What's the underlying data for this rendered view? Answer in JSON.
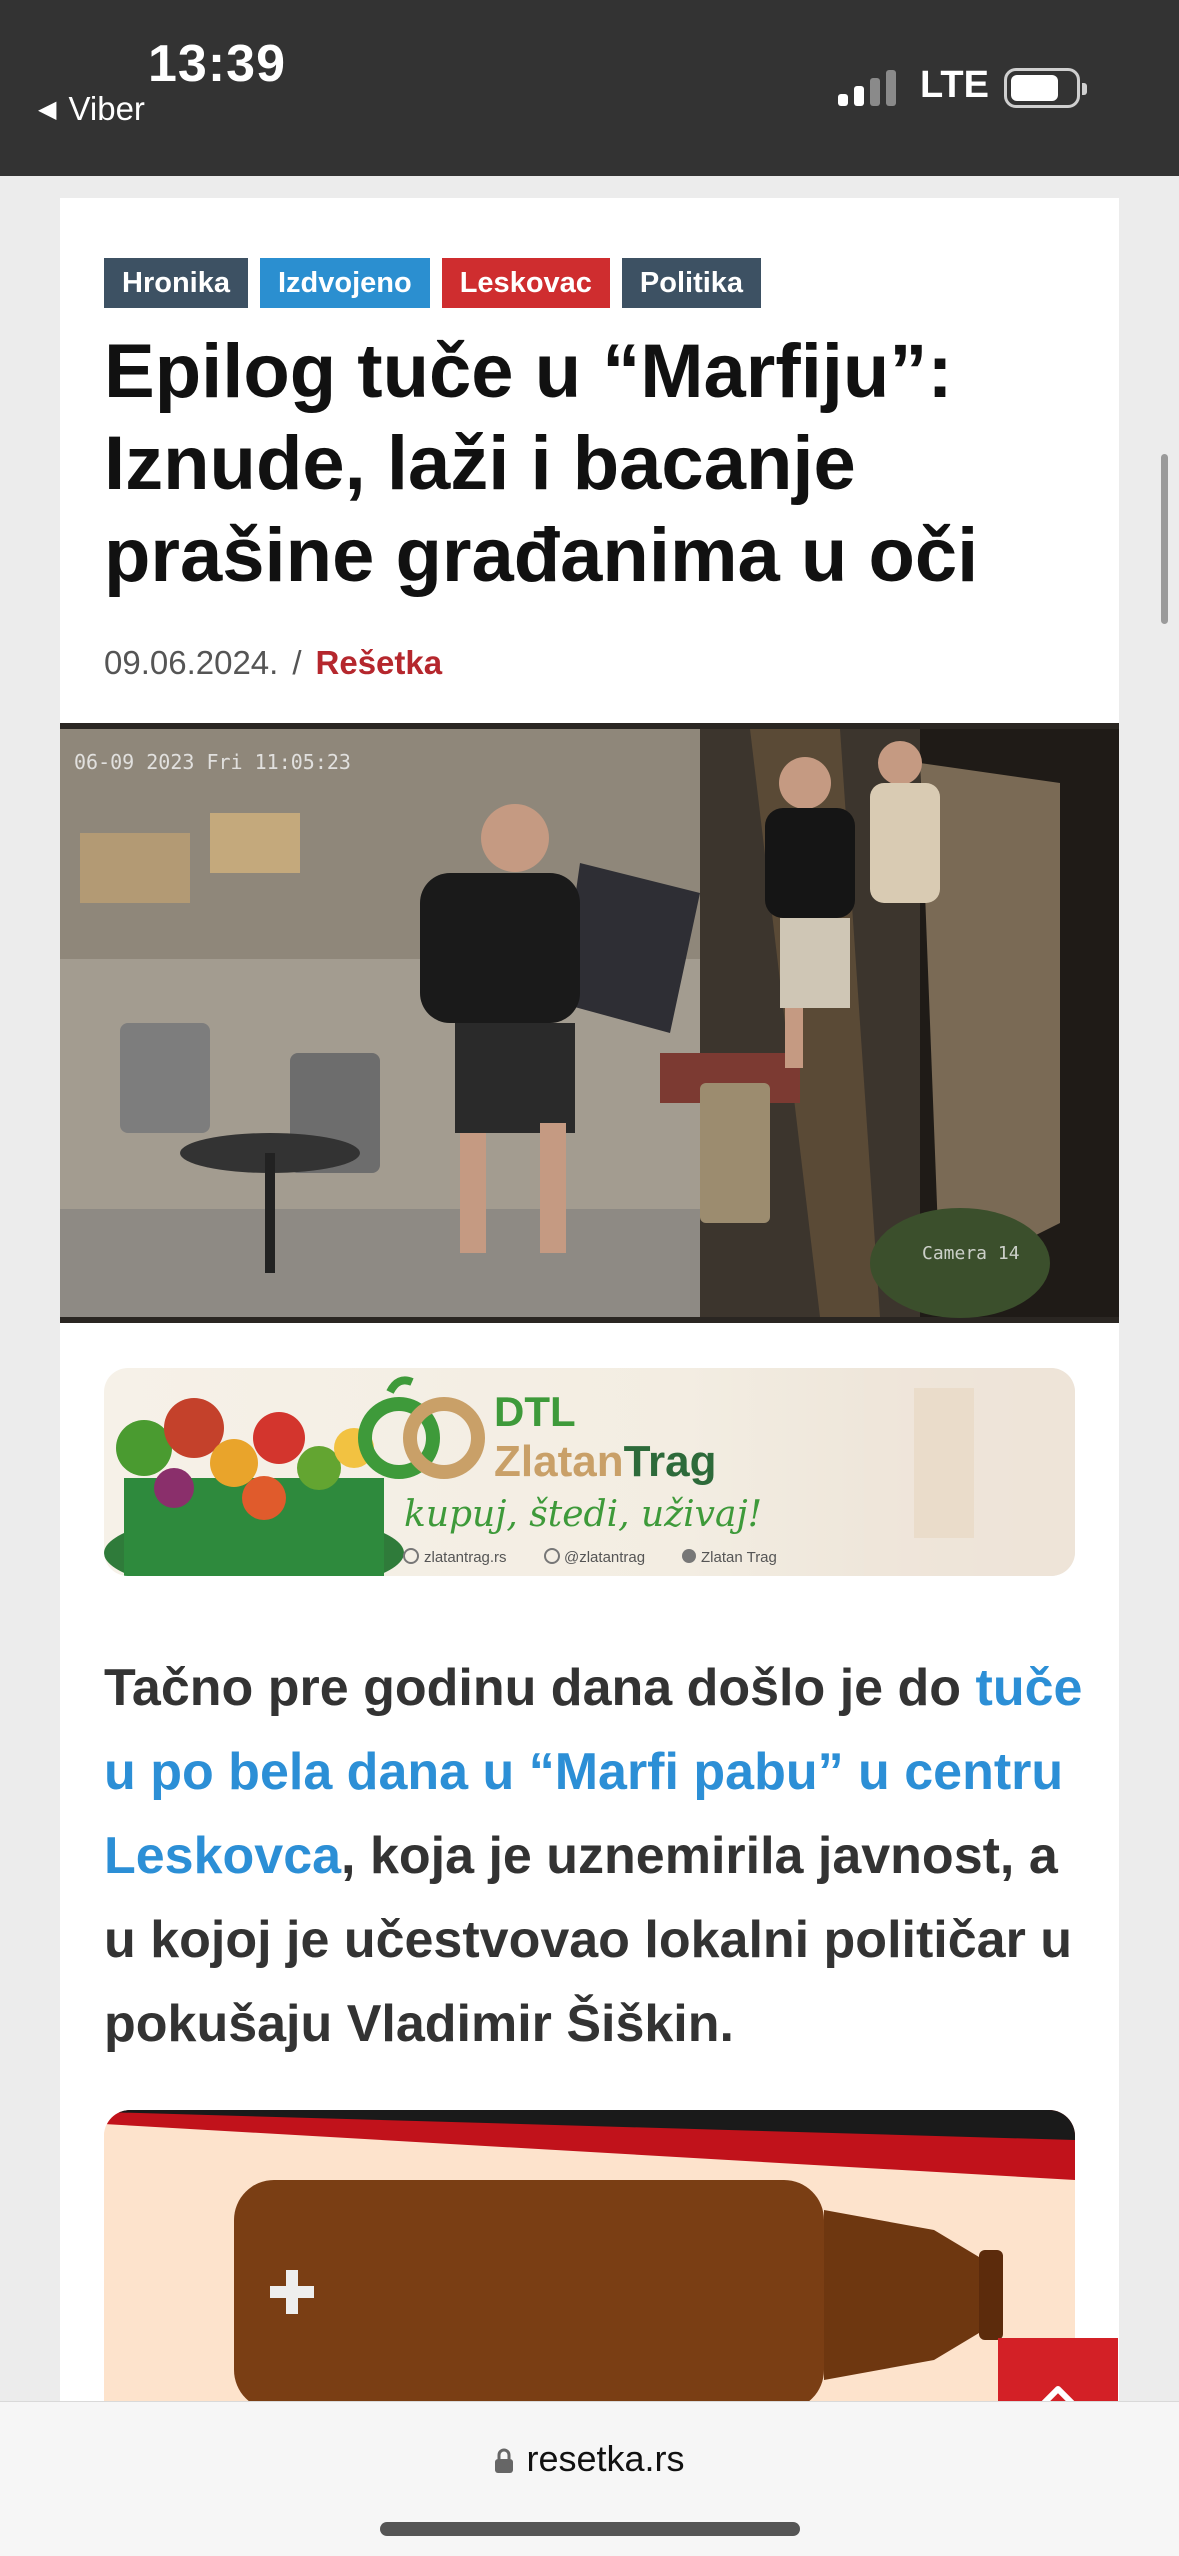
{
  "status_bar": {
    "time": "13:39",
    "back_app": "Viber",
    "network": "LTE",
    "icons": [
      "signal-icon",
      "battery-icon",
      "back-triangle-icon"
    ]
  },
  "article": {
    "categories": [
      {
        "label": "Hronika",
        "color": "#3d5163"
      },
      {
        "label": "Izdvojeno",
        "color": "#2b8fd0"
      },
      {
        "label": "Leskovac",
        "color": "#cf2d2f"
      },
      {
        "label": "Politika",
        "color": "#3d5163"
      }
    ],
    "title": "Epilog tuče u “Marfiju”: Iznude, laži i bacanje prašine građanima u oči",
    "date": "09.06.2024.",
    "separator": "/",
    "author": "Rešetka",
    "photo_timestamp": "06-09 2023 Fri 11:05:23",
    "photo_camera_label": "Camera 14",
    "body": {
      "part1": "Tačno pre godinu dana došlo je do ",
      "link": "tuče u po bela dana u “Marfi pabu” u centru Leskovca",
      "part2": ", koja je uznemirila javnost, a u kojoj je učestvovao lokalni političar u pokušaju Vladimir Šiškin."
    }
  },
  "banner_ad": {
    "brand_line1": "DTL",
    "brand_line2_a": "Zlatan",
    "brand_line2_b": "Trag",
    "slogan": "kupuj, štedi, uživaj!",
    "links": [
      "zlatantrag.rs",
      "@zlatantrag",
      "Zlatan Trag"
    ],
    "accent": "#3e9a3a"
  },
  "address_bar": {
    "url": "resetka.rs"
  },
  "colors": {
    "status_bar_bg": "#333333",
    "link": "#2c8fd6",
    "author": "#b5272d",
    "scroll_top_button": "#d32026"
  }
}
